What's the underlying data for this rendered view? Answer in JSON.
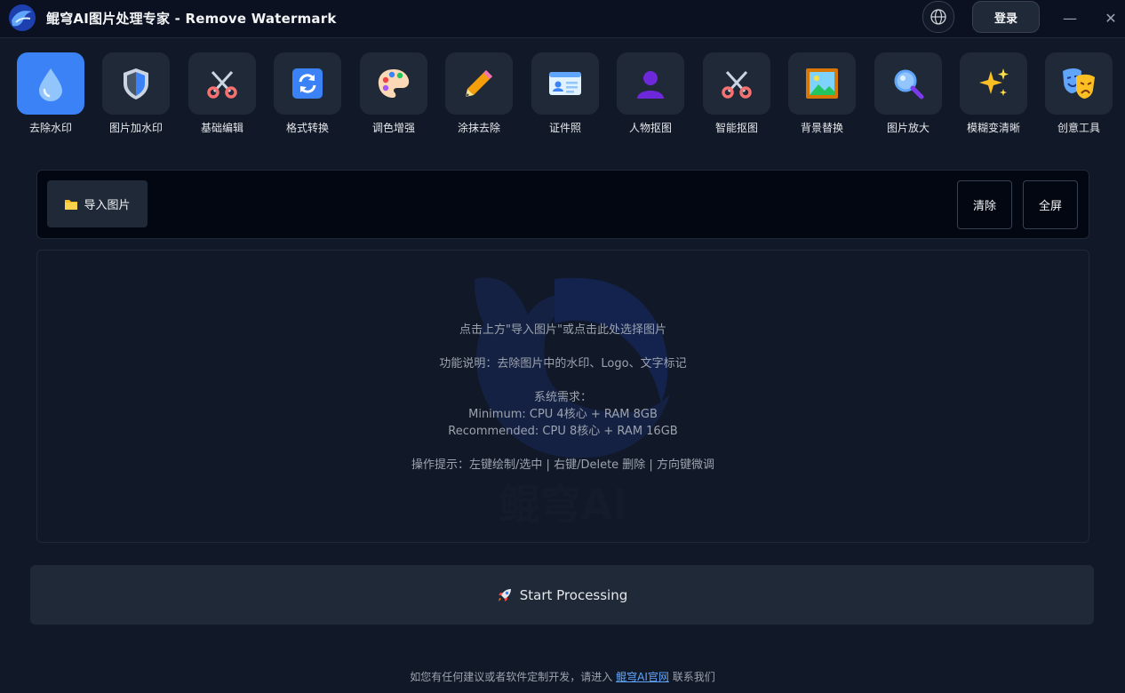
{
  "app": {
    "title": "鲲穹AI图片处理专家 - Remove Watermark",
    "login_label": "登录",
    "minimize_symbol": "—",
    "close_symbol": "✕"
  },
  "tools": [
    {
      "label": "去除水印",
      "icon": "water-drop-icon",
      "active": true
    },
    {
      "label": "图片加水印",
      "icon": "shield-icon",
      "active": false
    },
    {
      "label": "基础编辑",
      "icon": "scissors-icon",
      "active": false
    },
    {
      "label": "格式转换",
      "icon": "refresh-icon",
      "active": false
    },
    {
      "label": "调色增强",
      "icon": "palette-icon",
      "active": false
    },
    {
      "label": "涂抹去除",
      "icon": "pencil-icon",
      "active": false
    },
    {
      "label": "证件照",
      "icon": "id-card-icon",
      "active": false
    },
    {
      "label": "人物抠图",
      "icon": "person-icon",
      "active": false
    },
    {
      "label": "智能抠图",
      "icon": "scissors-icon",
      "active": false
    },
    {
      "label": "背景替换",
      "icon": "picture-icon",
      "active": false
    },
    {
      "label": "图片放大",
      "icon": "magnifier-icon",
      "active": false
    },
    {
      "label": "模糊变清晰",
      "icon": "sparkles-icon",
      "active": false
    },
    {
      "label": "创意工具",
      "icon": "masks-icon",
      "active": false
    }
  ],
  "import": {
    "import_label": "导入图片",
    "clear_label": "清除",
    "fullscreen_label": "全屏"
  },
  "dropzone": {
    "hint": "点击上方\"导入图片\"或点击此处选择图片",
    "description": "功能说明：去除图片中的水印、Logo、文字标记",
    "requirements_title": "系统需求：",
    "minimum": "Minimum: CPU 4核心 + RAM 8GB",
    "recommended": "Recommended: CPU 8核心 + RAM 16GB",
    "tips": "操作提示：左键绘制/选中 | 右键/Delete 删除 | 方向键微调",
    "watermark_text": "鲲穹AI"
  },
  "start": {
    "label": "Start Processing"
  },
  "footer": {
    "prefix": "如您有任何建议或者软件定制开发，请进入",
    "link": "鲲穹AI官网",
    "suffix": "联系我们"
  },
  "colors": {
    "background": "#111827",
    "accent": "#3b82f6",
    "tile": "#1f2937"
  }
}
